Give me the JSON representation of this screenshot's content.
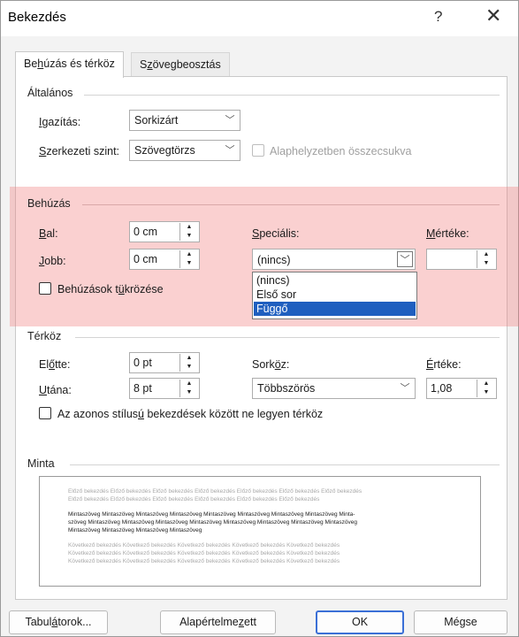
{
  "window": {
    "title": "Bekezdés",
    "help_icon": "?",
    "close_icon": "✕"
  },
  "tabs": [
    {
      "label_pre": "Be",
      "label_u": "h",
      "label_post": "úzás és térköz",
      "active": true
    },
    {
      "label_pre": "S",
      "label_u": "z",
      "label_post": "övegbeosztás",
      "active": false
    }
  ],
  "general": {
    "section": "Általános",
    "alignment": {
      "label_u": "I",
      "label_post": "gazítás:",
      "value": "Sorkizárt"
    },
    "outline": {
      "label_u": "S",
      "label_post": "zerkezeti szint:",
      "value": "Szövegtörzs"
    },
    "collapsed": {
      "label": "Alaphelyzetben összecsukva",
      "checked": false
    }
  },
  "indent": {
    "section": "Behúzás",
    "left": {
      "label_u": "B",
      "label_post": "al:",
      "value": "0 cm"
    },
    "right": {
      "label_u": "J",
      "label_post": "obb:",
      "value": "0 cm"
    },
    "special": {
      "label_u": "S",
      "label_post": "peciális:",
      "value": "(nincs)"
    },
    "by": {
      "label_u": "M",
      "label_post": "értéke:",
      "value": ""
    },
    "mirror": {
      "label_pre": "Behúzások t",
      "label_u": "ü",
      "label_post": "krözése",
      "checked": false
    },
    "special_options": [
      "(nincs)",
      "Első sor",
      "Függő"
    ],
    "special_option_selected": 2
  },
  "spacing": {
    "section": "Térköz",
    "before": {
      "label_pre": "El",
      "label_u": "ő",
      "label_post": "tte:",
      "value": "0 pt"
    },
    "after": {
      "label_u": "U",
      "label_post": "tána:",
      "value": "8 pt"
    },
    "line": {
      "label_pre": "Sork",
      "label_u": "ö",
      "label_post": "z:",
      "value": "Többszörös"
    },
    "at": {
      "label_u": "É",
      "label_post": "rtéke:",
      "value": "1,08"
    },
    "no_space": {
      "label_pre": "Az azonos stílus",
      "label_u": "ú",
      "label_post": " bekezdések között ne legyen térköz",
      "checked": false
    }
  },
  "preview": {
    "section": "Minta",
    "prev_lines": [
      "Előző bekezdés Előző bekezdés Előző bekezdés Előző bekezdés Előző bekezdés Előző bekezdés Előző bekezdés",
      "Előző bekezdés Előző bekezdés Előző bekezdés Előző bekezdés Előző bekezdés Előző bekezdés"
    ],
    "sample_lines": [
      "Mintaszöveg Mintaszöveg Mintaszöveg Mintaszöveg Mintaszöveg Mintaszöveg Mintaszöveg Mintaszöveg Minta-",
      "szöveg Mintaszöveg Mintaszöveg Mintaszöveg Mintaszöveg Mintaszöveg Mintaszöveg Mintaszöveg Mintaszöveg",
      "Mintaszöveg Mintaszöveg Mintaszöveg Mintaszöveg"
    ],
    "next_lines": [
      "Következő bekezdés Következő bekezdés Következő bekezdés Következő bekezdés Következő bekezdés",
      "Következő bekezdés Következő bekezdés Következő bekezdés Következő bekezdés Következő bekezdés",
      "Következő bekezdés Következő bekezdés Következő bekezdés Következő bekezdés Következő bekezdés"
    ]
  },
  "footer": {
    "tabs_btn": {
      "label_pre": "Tabul",
      "label_u": "á",
      "label_post": "torok..."
    },
    "default_btn": {
      "label_pre": "Alapértelme",
      "label_u": "z",
      "label_post": "ett"
    },
    "ok_btn": "OK",
    "cancel_btn": "Mégse"
  },
  "colors": {
    "highlight": "#f07878",
    "selection": "#1f5fbf",
    "primary_border": "#3a6fd6"
  }
}
